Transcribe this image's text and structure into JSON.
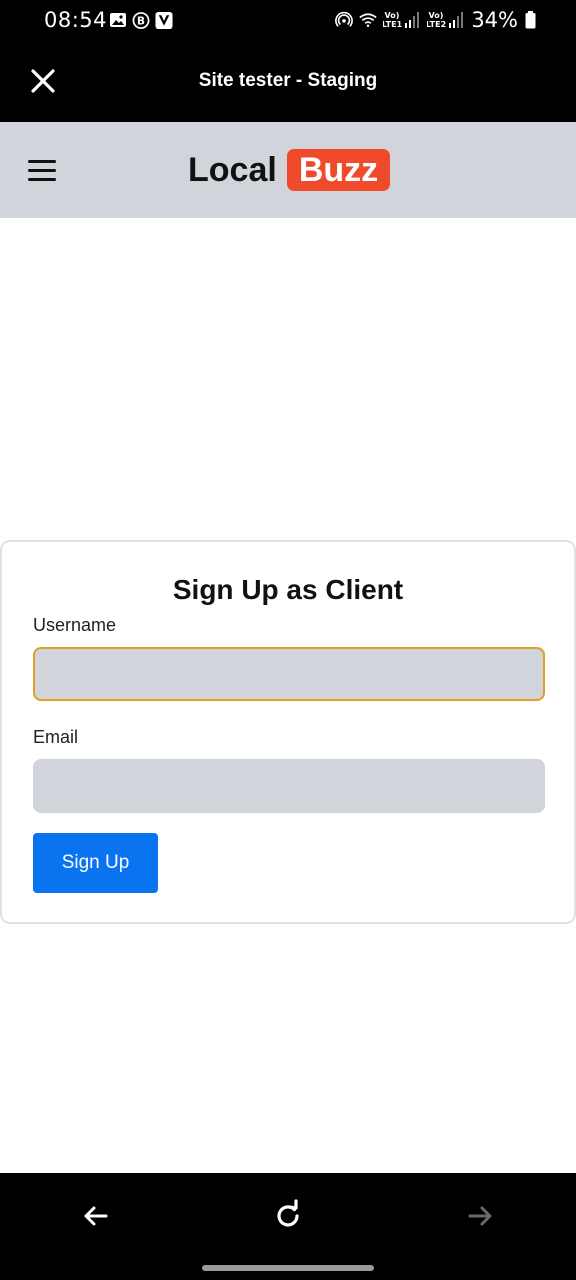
{
  "status_bar": {
    "time": "08:54",
    "battery_percent": "34%",
    "left_icons": [
      "image-icon",
      "b-badge-icon",
      "v-app-icon"
    ],
    "right_icons": [
      "hotspot-icon",
      "wifi-icon",
      "signal-lte1-icon",
      "signal-lte2-icon",
      "battery-icon"
    ],
    "lte1_label": "Vo) LTE1",
    "lte2_label": "Vo) LTE2"
  },
  "toolbar": {
    "title": "Site tester - Staging",
    "close_icon": "close-icon"
  },
  "site_header": {
    "brand_local": "Local",
    "brand_buzz": "Buzz",
    "brand_accent_color": "#f04a2c",
    "header_bg_color": "#d1d5db",
    "menu_icon": "hamburger-menu-icon"
  },
  "form": {
    "title": "Sign Up as Client",
    "username_label": "Username",
    "username_value": "",
    "email_label": "Email",
    "email_value": "",
    "submit_label": "Sign Up",
    "submit_color": "#0a73f0",
    "focus_outline_color": "#e0a020"
  },
  "bottom_nav": {
    "back_icon": "arrow-left-icon",
    "reload_icon": "reload-icon",
    "forward_icon": "arrow-right-icon",
    "forward_enabled": false
  }
}
